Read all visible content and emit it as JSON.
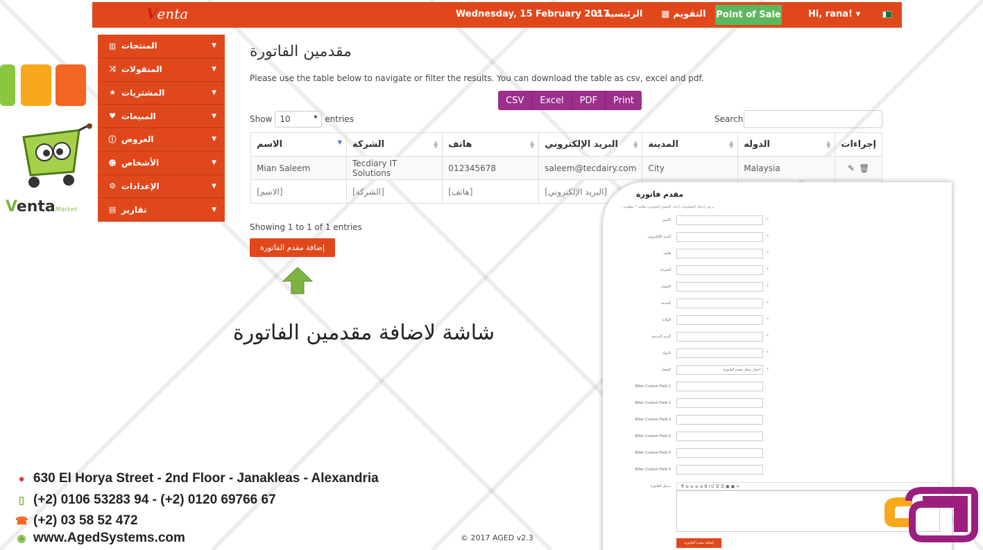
{
  "topbar": {
    "logo": "Venta",
    "date": "Wednesday, 15 February 2017",
    "home_label": "الرئيسية",
    "calendar_label": "التقويم",
    "pos_label": "Point of Sale",
    "user_label": "Hi, rana! ▾"
  },
  "brand": {
    "left_logo_main": "enta",
    "left_logo_v": "V",
    "left_logo_sub": "Market"
  },
  "sidebar": {
    "items": [
      {
        "label": "المنتجات",
        "icon": "barcode-icon"
      },
      {
        "label": "المنقولات",
        "icon": "shuffle-icon"
      },
      {
        "label": "المشتريات",
        "icon": "star-icon"
      },
      {
        "label": "المبيعات",
        "icon": "heart-icon"
      },
      {
        "label": "العروض",
        "icon": "info-icon"
      },
      {
        "label": "الأشخاص",
        "icon": "user-icon"
      },
      {
        "label": "الإعدادات",
        "icon": "cog-icon"
      },
      {
        "label": "تقارير",
        "icon": "report-icon"
      }
    ]
  },
  "main": {
    "title": "مقدمين الفاتورة",
    "intro": "Please use the table below to navigate or filter the results. You can download the table as csv, excel and pdf.",
    "export": [
      "CSV",
      "Excel",
      "PDF",
      "Print"
    ],
    "show_label": "Show",
    "show_value": "10",
    "entries_label": "entries",
    "search_label": "Search",
    "columns": [
      "الاسم",
      "الشركة",
      "هاتف",
      "البريد الإلكتروني",
      "المدينة",
      "الدوله",
      "إجراءات"
    ],
    "rows": [
      [
        "Mian Saleem",
        "Tecdiary IT Solutions",
        "012345678",
        "saleem@tecdairy.com",
        "City",
        "Malaysia"
      ]
    ],
    "filters": [
      "[الاسم]",
      "[الشركة]",
      "[هاتف]",
      "[البريد الإلكتروني]"
    ],
    "showing": "Showing 1 to 1 of 1 entries",
    "add_button": "إضافة مقدم الفاتورة",
    "caption": "شاشة لاضافة مقدمين الفاتورة"
  },
  "panel": {
    "title": "مقدم فاتورة",
    "note": "يرجى إدخال المعلومات أدناه. الحقول المؤشرة بعلامة * مطلوبة.",
    "fields": [
      {
        "label": "الاسم",
        "req": "*"
      },
      {
        "label": "البريد الإلكتروني",
        "req": "*"
      },
      {
        "label": "هاتف",
        "req": "*"
      },
      {
        "label": "الشركة",
        "req": "*"
      },
      {
        "label": "العنوان",
        "req": "*"
      },
      {
        "label": "المدينة",
        "req": "*"
      },
      {
        "label": "الولاية",
        "req": "*"
      },
      {
        "label": "الرمز البريدي",
        "req": "*"
      },
      {
        "label": "الدولة",
        "req": "*"
      },
      {
        "label": "الشعار",
        "req": "*",
        "select": "اختيار شعار مقدم الفاتورة"
      },
      {
        "label": "Biller Custom Field 1",
        "req": ""
      },
      {
        "label": "Biller Custom Field 2",
        "req": ""
      },
      {
        "label": "Biller Custom Field 3",
        "req": ""
      },
      {
        "label": "Biller Custom Field 4",
        "req": ""
      },
      {
        "label": "Biller Custom Field 5",
        "req": ""
      },
      {
        "label": "Biller Custom Field 6",
        "req": ""
      }
    ],
    "editor_label": "تذييل الفاتورة",
    "toolbar": "¶  ≡  ≡  ≡  ≡  B  I  U  ☰  ☰  ▣  ▣  ∞",
    "submit": "إضافة مقدم الفاتورة"
  },
  "footer": {
    "address": "630 El Horya Street - 2nd Floor - Janakleas - Alexandria",
    "mobile": "(+2) 0106 53283 94 - (+2) 0120 69766 67",
    "phone": "(+2) 03 58 52 472",
    "website": "www.AgedSystems.com",
    "copyright": "© 2017 AGED v2.3"
  },
  "colors": {
    "brand_orange": "#e0481c",
    "pos_green": "#5cb85c",
    "export_purple": "#9c2f8a",
    "arrow_green": "#7cb342"
  }
}
